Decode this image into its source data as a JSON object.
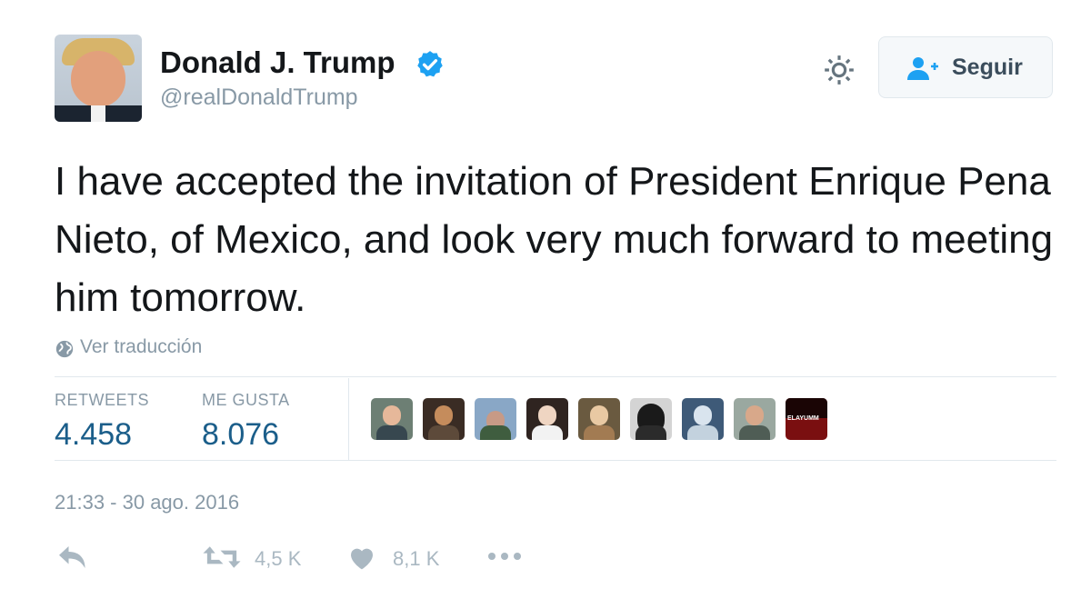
{
  "user": {
    "display_name": "Donald J. Trump",
    "handle": "@realDonaldTrump",
    "verified": true
  },
  "header": {
    "follow_label": "Seguir",
    "settings_icon": "gear-icon",
    "follow_icon": "add-user-icon"
  },
  "tweet": {
    "text": "I have accepted the invitation of President Enrique Pena Nieto, of Mexico, and look very much forward to meeting him tomorrow.",
    "translate_label": "Ver traducción",
    "translate_icon": "globe-icon",
    "timestamp": "21:33 - 30 ago. 2016"
  },
  "stats": {
    "retweets_label": "RETWEETS",
    "retweets_value": "4.458",
    "likes_label": "ME GUSTA",
    "likes_value": "8.076"
  },
  "likers": [
    {
      "name": "liker-1"
    },
    {
      "name": "liker-2"
    },
    {
      "name": "liker-3"
    },
    {
      "name": "liker-4"
    },
    {
      "name": "liker-5"
    },
    {
      "name": "liker-6"
    },
    {
      "name": "liker-7"
    },
    {
      "name": "liker-8"
    },
    {
      "name": "liker-9",
      "caption": "ELAYUMM"
    }
  ],
  "actions": {
    "reply_icon": "reply-icon",
    "retweet_icon": "retweet-icon",
    "retweet_count": "4,5 K",
    "like_icon": "heart-icon",
    "like_count": "8,1 K",
    "more_icon": "more-icon"
  },
  "colors": {
    "verified_blue": "#1da1f2",
    "stat_value": "#1b5e8a",
    "muted_text": "#8899a6",
    "action_gray": "#aab8c2"
  }
}
